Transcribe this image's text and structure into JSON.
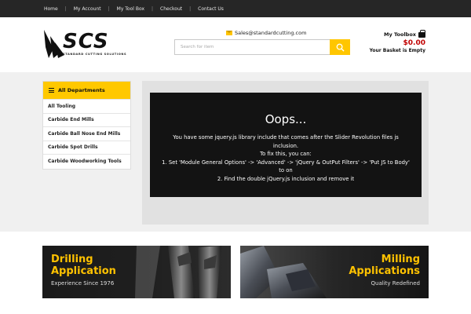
{
  "topnav": {
    "items": [
      "Home",
      "My Account",
      "My Tool Box",
      "Checkout",
      "Contact Us"
    ],
    "separator": "|"
  },
  "header": {
    "logo_text": "SCS",
    "logo_sub": "STANDARD CUTTING SOLUTIONS",
    "email_icon": "envelope-icon",
    "email": "Sales@standardcutting.com",
    "search_placeholder": "Search for item",
    "search_icon": "search-icon",
    "toolbox_title": "My Toolbox",
    "toolbox_icon": "briefcase-icon",
    "price": "$0.00",
    "basket_status": "Your Basket is Empty"
  },
  "departments": {
    "heading": "All Departments",
    "heading_icon": "list-icon",
    "items": [
      "All Tooling",
      "Carbide End Mills",
      "Carbide Ball Nose End Mills",
      "Carbide Spot Drills",
      "Carbide Woodworking Tools"
    ]
  },
  "slider": {
    "title": "Oops...",
    "lines": [
      "You have some jquery.js library include that comes after the Slider Revolution files js inclusion.",
      "To fix this, you can:",
      "1. Set 'Module General Options' -> 'Advanced' -> 'jQuery & OutPut Filters' -> 'Put JS to Body' to on",
      "2. Find the double jQuery.js inclusion and remove it"
    ]
  },
  "banners": {
    "left": {
      "title_line1": "Drilling",
      "title_line2": "Application",
      "subtitle": "Experience Since 1976"
    },
    "right": {
      "title_line1": "Milling",
      "title_line2": "Applications",
      "subtitle": "Quality Redefined"
    }
  },
  "colors": {
    "accent": "#ffc600",
    "dark": "#262626",
    "price": "#c00000"
  }
}
